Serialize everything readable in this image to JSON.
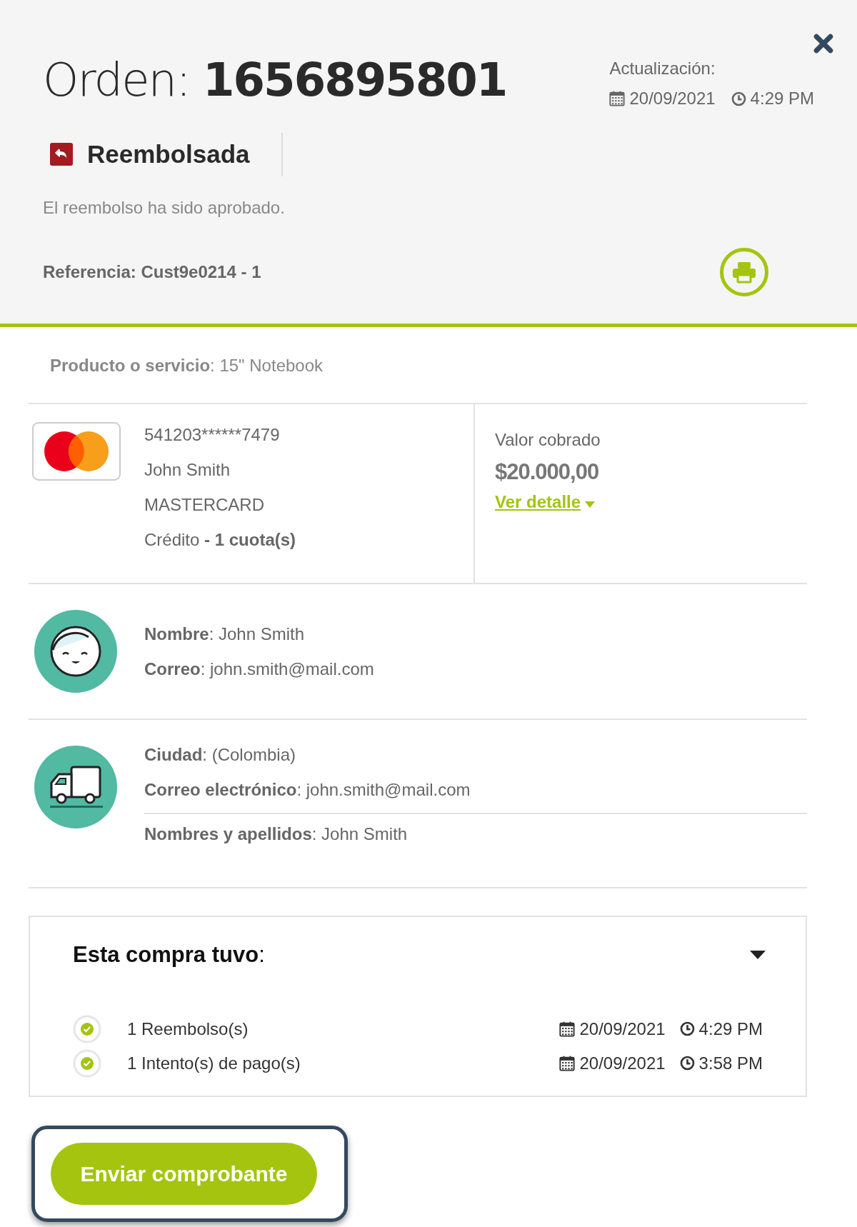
{
  "order": {
    "title_label": "Orden:",
    "number": "1656895801"
  },
  "update": {
    "label": "Actualización:",
    "date": "20/09/2021",
    "time": "4:29 PM"
  },
  "status": {
    "label": "Reembolsada",
    "description": "El reembolso ha sido aprobado."
  },
  "reference": "Referencia: Cust9e0214 - 1",
  "product": "**Producto o servicio**: 15\" Notebook",
  "payment": {
    "card_number": "541203******7479",
    "holder": "John Smith",
    "brand": "MASTERCARD",
    "type_line": "Crédito **- 1 cuota(s)**",
    "amount_label": "Valor cobrado",
    "amount": "$20.000,00",
    "detail_link": "Ver detalle"
  },
  "customer": [
    "**Nombre**: John Smith",
    "**Correo**: john.smith@mail.com"
  ],
  "shipping": [
    "**Ciudad**: (Colombia)",
    "**Correo electrónico**: john.smith@mail.com"
  ],
  "shipping_extra": "**Nombres y apellidos**: John Smith",
  "history": {
    "title": "**Esta compra tuvo**:",
    "expanded": true,
    "events": [
      {
        "label": "1 Reembolso(s)",
        "date": "20/09/2021",
        "time": "4:29 PM",
        "completed": true
      },
      {
        "label": "1 Intento(s) de pago(s)",
        "date": "20/09/2021",
        "time": "3:58 PM",
        "completed": true
      }
    ]
  },
  "send_button": "Enviar comprobante"
}
